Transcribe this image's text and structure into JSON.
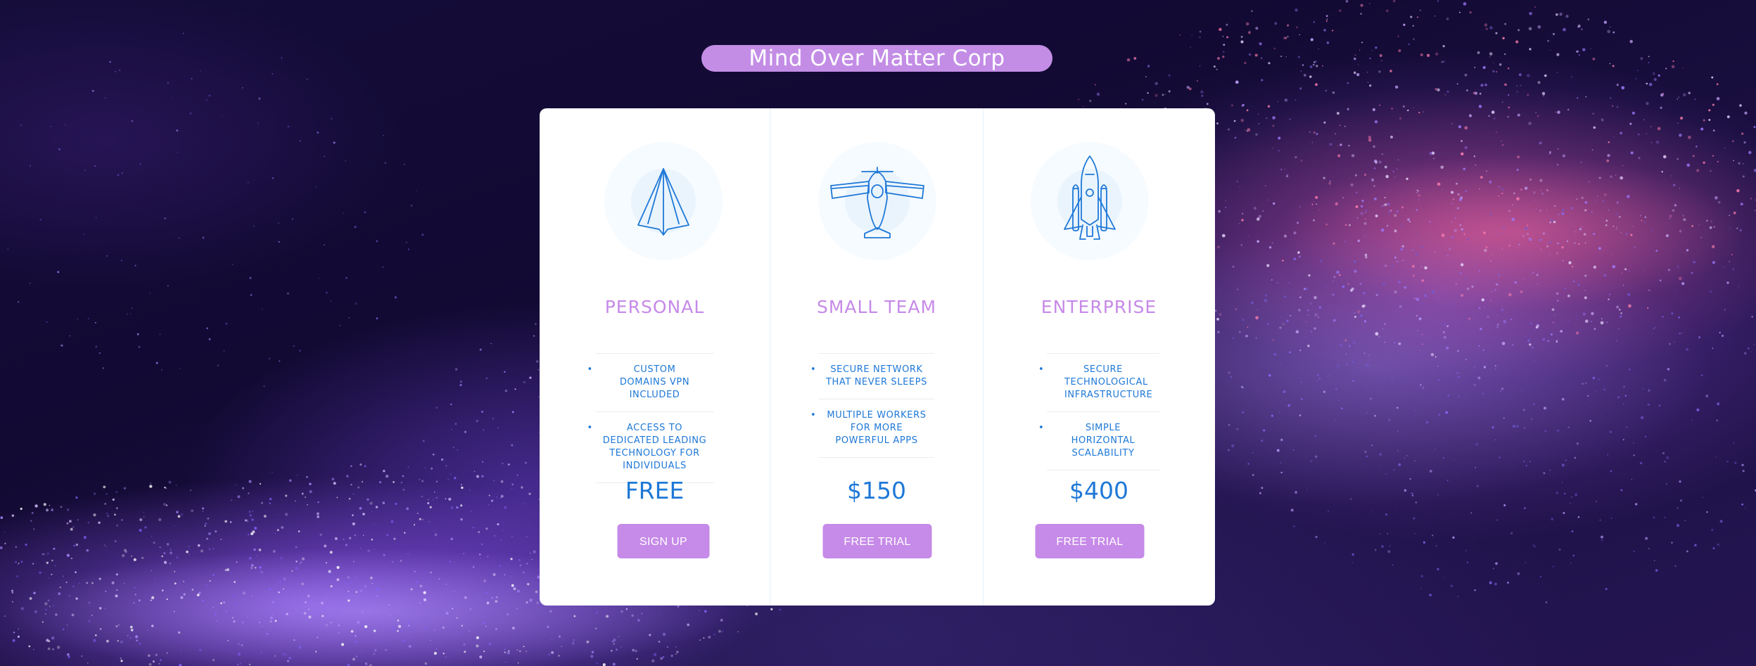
{
  "page": {
    "title": "Mind Over Matter Corp"
  },
  "colors": {
    "accent": "#c68ae8",
    "text_blue": "#1e78d7",
    "card_bg": "#ffffff",
    "background_dark": "#120a33"
  },
  "plans": [
    {
      "icon": "paper-plane-icon",
      "name": "PERSONAL",
      "features": [
        "CUSTOM DOMAINS VPN INCLUDED",
        "ACCESS TO DEDICATED LEADING TECHNOLOGY FOR INDIVIDUALS"
      ],
      "price": "FREE",
      "cta_label": "SIGN UP"
    },
    {
      "icon": "airplane-icon",
      "name": "SMALL TEAM",
      "features": [
        "SECURE NETWORK THAT NEVER SLEEPS",
        "MULTIPLE WORKERS FOR MORE POWERFUL APPS"
      ],
      "price": "$150",
      "cta_label": "FREE TRIAL"
    },
    {
      "icon": "space-shuttle-icon",
      "name": "ENTERPRISE",
      "features": [
        "SECURE TECHNOLOGICAL INFRASTRUCTURE",
        "SIMPLE HORIZONTAL SCALABILITY"
      ],
      "price": "$400",
      "cta_label": "FREE TRIAL"
    }
  ]
}
